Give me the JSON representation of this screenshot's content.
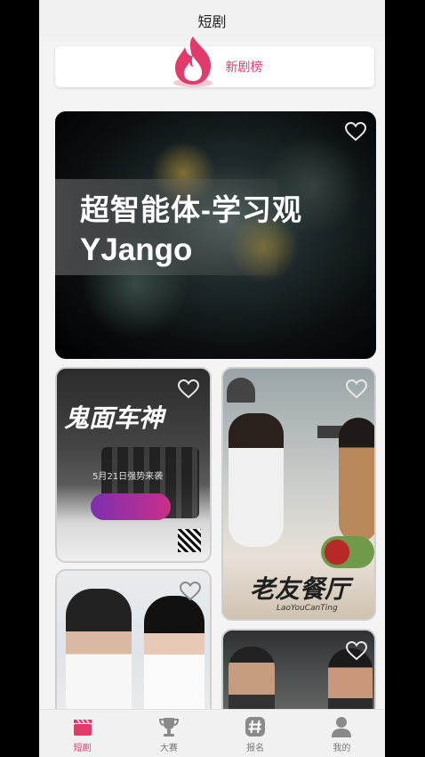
{
  "header": {
    "title": "短剧"
  },
  "banner": {
    "label": "新剧榜",
    "icon": "fire-icon"
  },
  "featured": {
    "line1": "超智能体-学习观",
    "line2": "YJango"
  },
  "posters": [
    {
      "title_big": "鬼面车神",
      "subtitle": "5月21日强势来袭"
    },
    {
      "title_big": "老友餐厅",
      "subtitle": "LaoYouCanTing"
    }
  ],
  "tabs": [
    {
      "label": "短剧",
      "icon": "clapperboard-icon",
      "active": true
    },
    {
      "label": "大赛",
      "icon": "trophy-icon",
      "active": false
    },
    {
      "label": "报名",
      "icon": "hashtag-icon",
      "active": false
    },
    {
      "label": "我的",
      "icon": "user-icon",
      "active": false
    }
  ],
  "colors": {
    "accent": "#e23a6b",
    "background": "#f4f4f4"
  }
}
